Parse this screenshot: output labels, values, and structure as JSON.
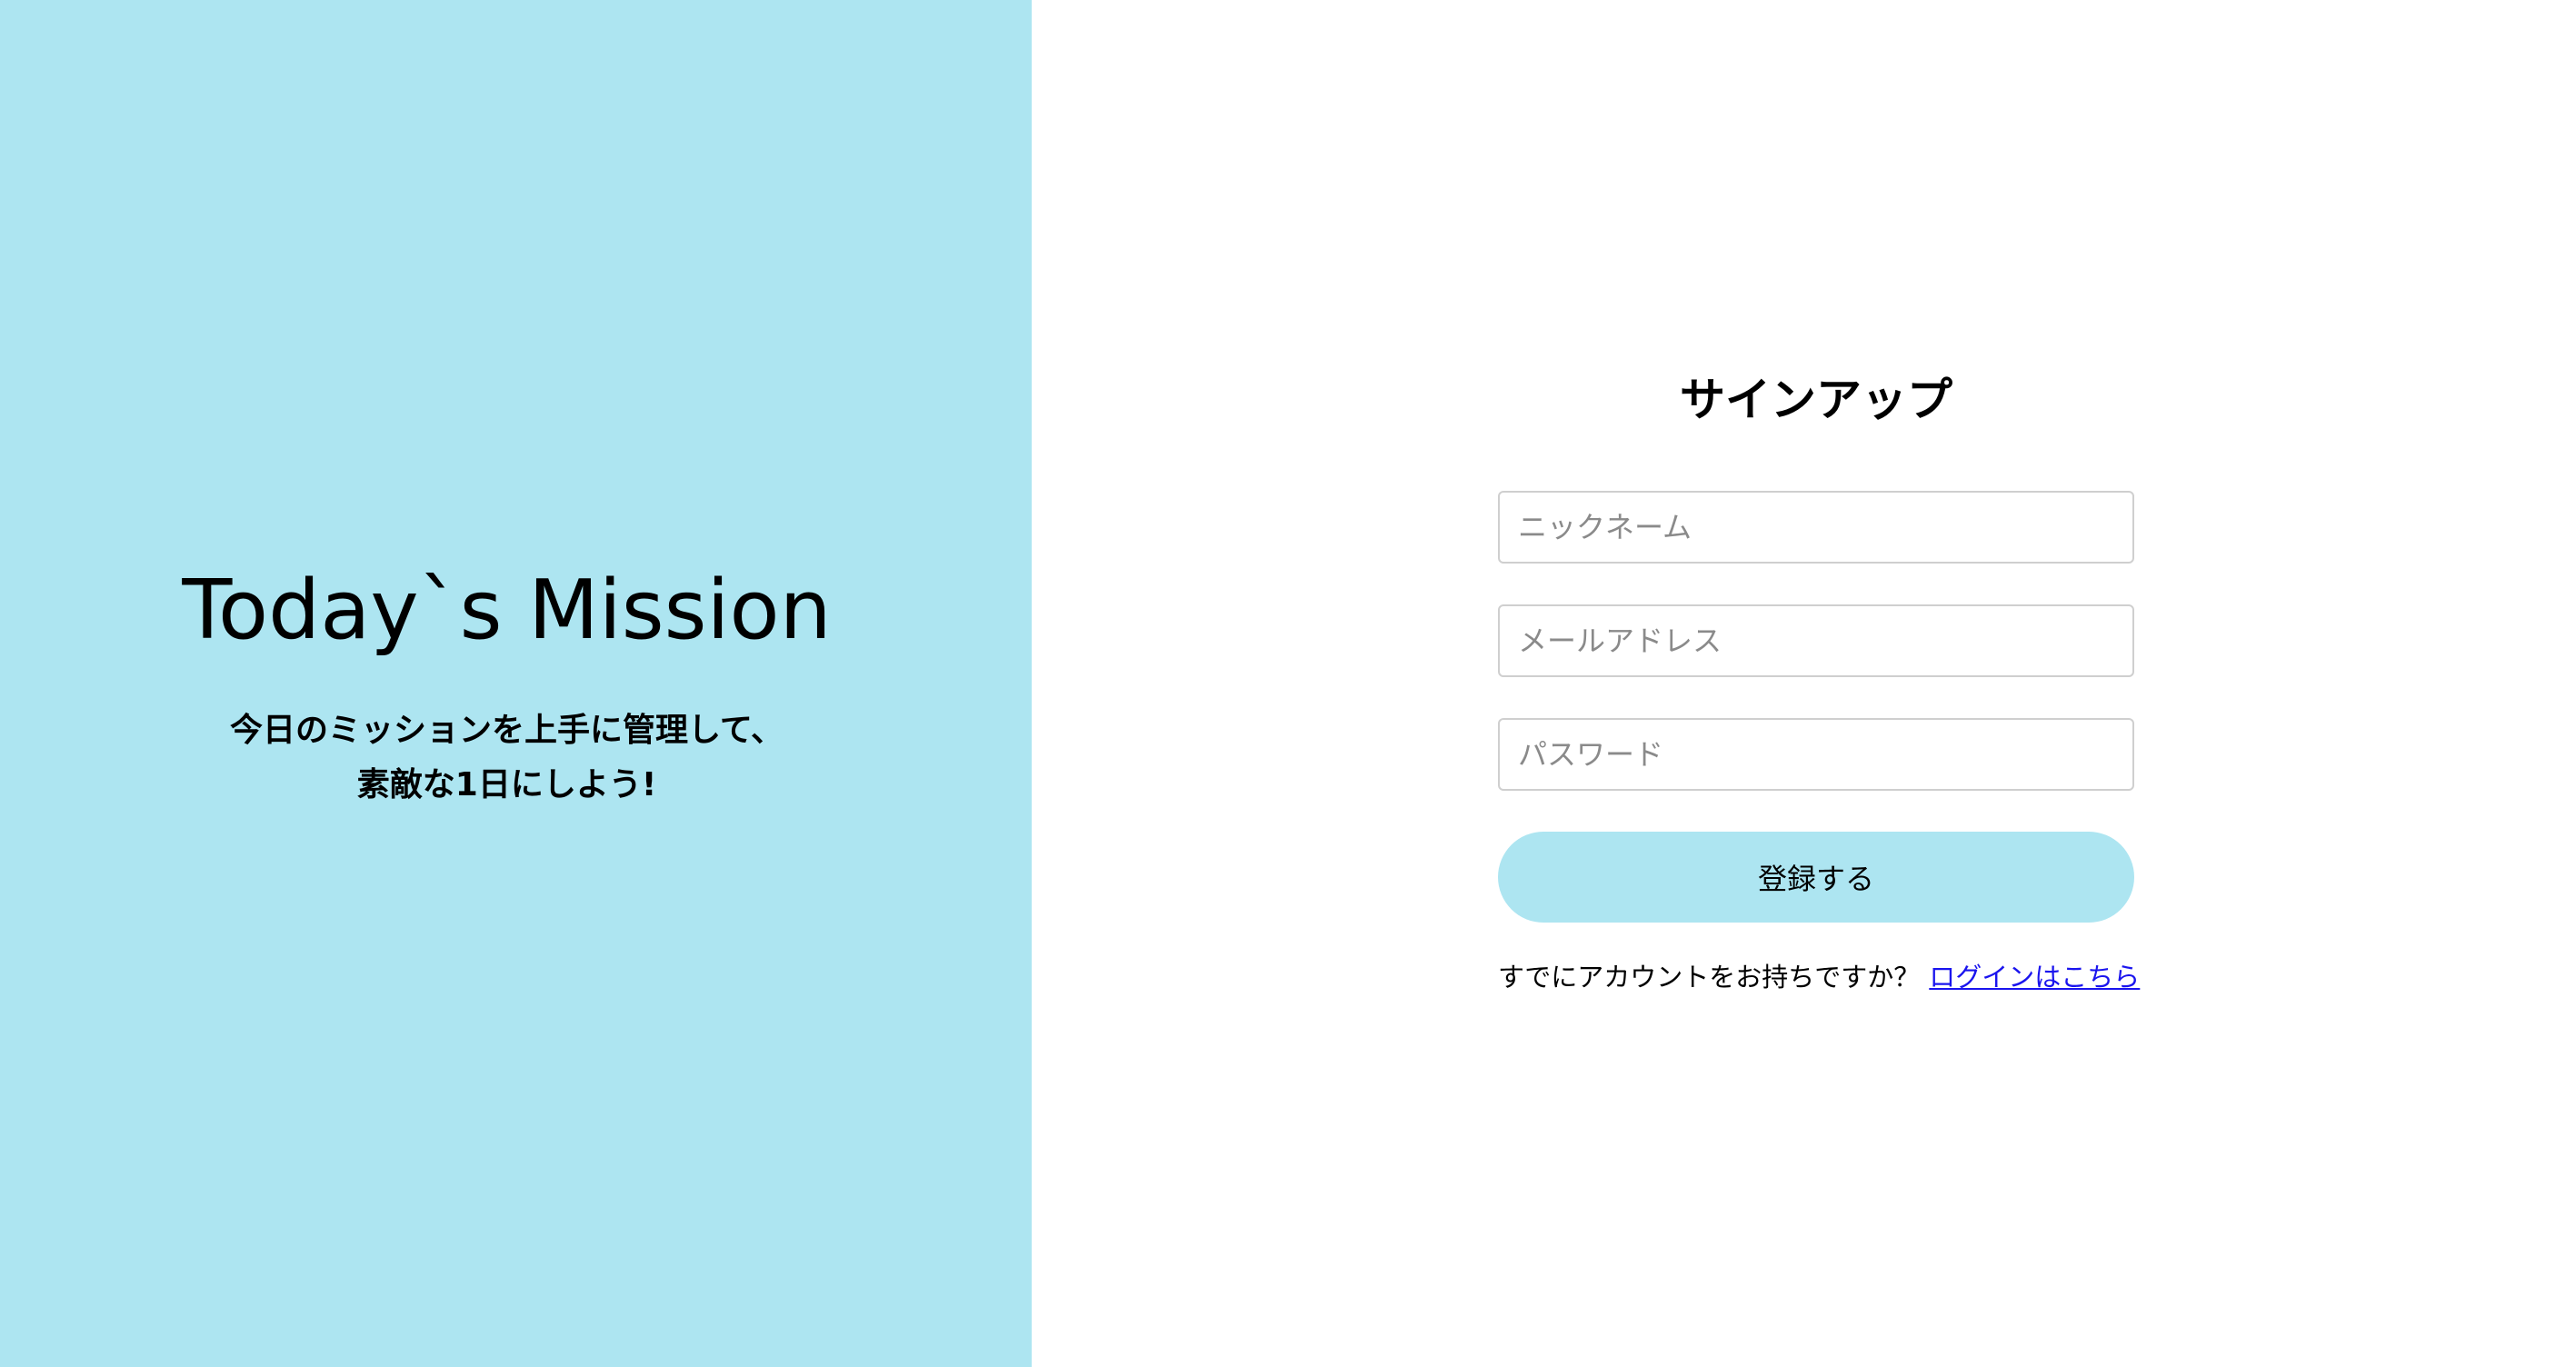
{
  "hero": {
    "title": "Today`s Mission",
    "tagline_line1": "今日のミッションを上手に管理して、",
    "tagline_line2": "素敵な1日にしよう!",
    "background_color": "#ade5f1"
  },
  "signup": {
    "title": "サインアップ",
    "nickname_placeholder": "ニックネーム",
    "nickname_value": "",
    "email_placeholder": "メールアドレス",
    "email_value": "",
    "password_placeholder": "パスワード",
    "password_value": "",
    "submit_label": "登録する",
    "submit_color": "#ade5f1",
    "login_prompt": "すでにアカウントをお持ちですか？",
    "login_link": "ログインはこちら",
    "link_color": "#1a14ee"
  }
}
